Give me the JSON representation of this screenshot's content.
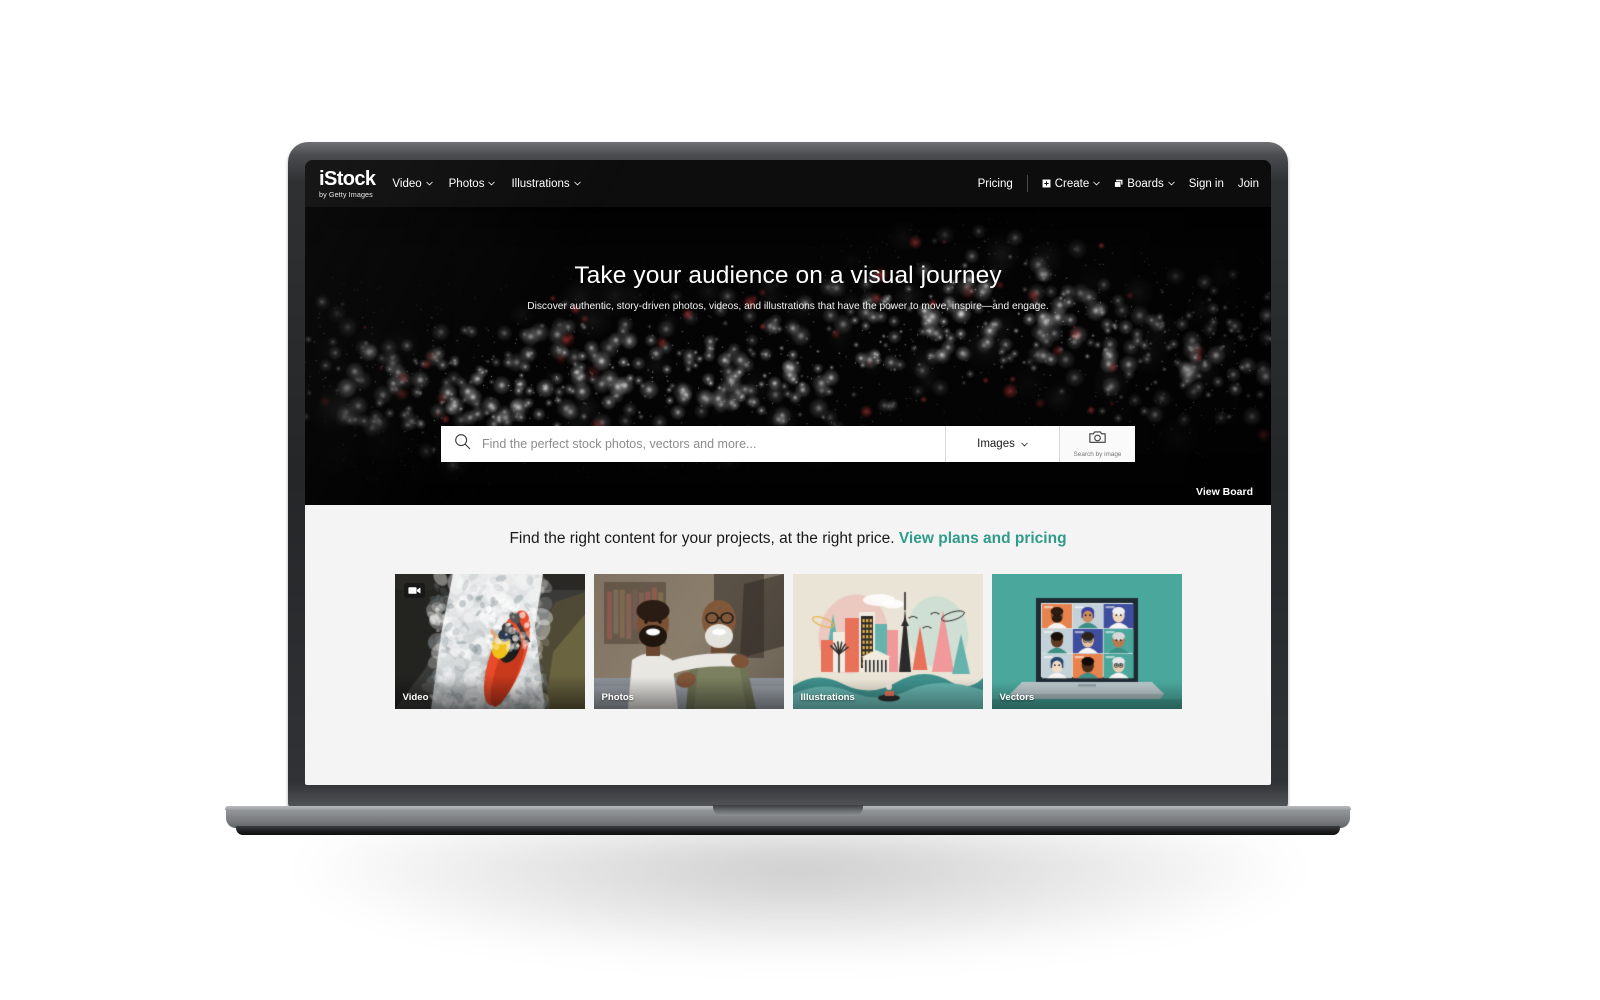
{
  "brand": {
    "logo_main": "iStock",
    "logo_sub": "by Getty Images"
  },
  "nav": {
    "left_items": [
      {
        "label": "Video",
        "has_caret": true
      },
      {
        "label": "Photos",
        "has_caret": true
      },
      {
        "label": "Illustrations",
        "has_caret": true
      }
    ],
    "right_items": [
      {
        "label": "Pricing",
        "has_caret": false,
        "icon": ""
      },
      {
        "label": "Create",
        "has_caret": true,
        "icon": "plus-square-icon"
      },
      {
        "label": "Boards",
        "has_caret": true,
        "icon": "boards-icon"
      },
      {
        "label": "Sign in",
        "has_caret": false,
        "icon": ""
      },
      {
        "label": "Join",
        "has_caret": false,
        "icon": ""
      }
    ]
  },
  "hero": {
    "title": "Take your audience on a visual journey",
    "subtitle": "Discover authentic, story-driven photos, videos, and illustrations that have the power to move, inspire—and engage.",
    "view_board_label": "View Board"
  },
  "search": {
    "placeholder": "Find the perfect stock photos, vectors and more...",
    "value": "",
    "type_selected": "Images",
    "search_by_image_label": "Search by image",
    "search_icon": "search-icon",
    "camera_icon": "camera-icon"
  },
  "content": {
    "heading_text": "Find the right content for your projects, at the right price.",
    "heading_link": "View plans and pricing",
    "link_color": "#319b8a",
    "cards": [
      {
        "label": "Video",
        "art": "kayak",
        "badge": "video-camera-icon"
      },
      {
        "label": "Photos",
        "art": "portrait",
        "badge": ""
      },
      {
        "label": "Illustrations",
        "art": "cityscape",
        "badge": ""
      },
      {
        "label": "Vectors",
        "art": "videocall",
        "badge": ""
      }
    ]
  }
}
